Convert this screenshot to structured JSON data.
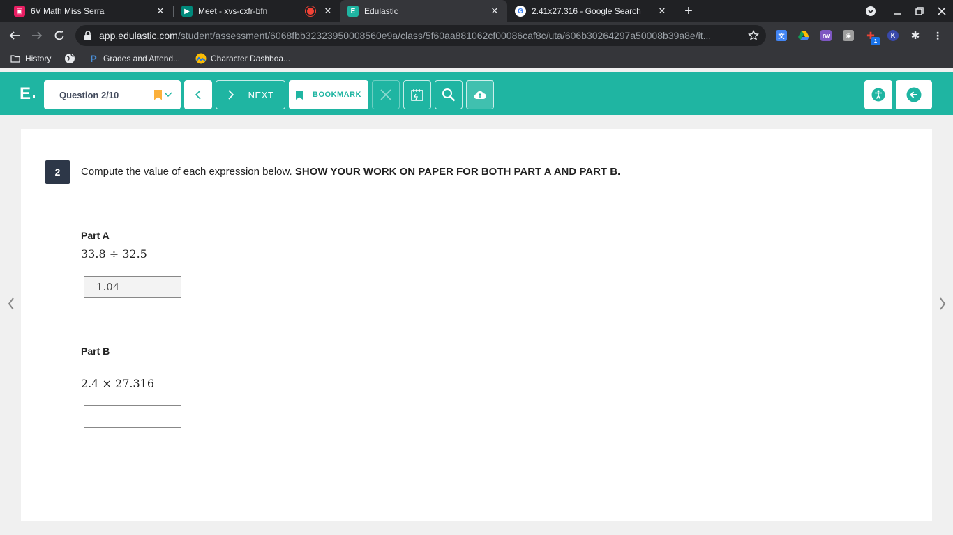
{
  "browser": {
    "tabs": [
      {
        "title": "6V Math Miss Serra",
        "favicon": "classroom-icon"
      },
      {
        "title": "Meet - xvs-cxfr-bfn",
        "favicon": "meet-icon",
        "recording": true
      },
      {
        "title": "Edulastic",
        "favicon": "edulastic-icon",
        "active": true
      },
      {
        "title": "2.41x27.316 - Google Search",
        "favicon": "google-icon"
      }
    ],
    "url_host": "app.edulastic.com",
    "url_path": "/student/assessment/6068fbb32323950008560e9a/class/5f60aa881062cf00086caf8c/uta/606b30264297a50008b39a8e/it...",
    "extension_badge": "1",
    "bookmarks": [
      {
        "label": "History",
        "icon": "folder-icon"
      },
      {
        "label": "",
        "icon": "globe-icon"
      },
      {
        "label": "Grades and Attend...",
        "icon": "powerschool-icon"
      },
      {
        "label": "Character Dashboa...",
        "icon": "character-icon"
      }
    ]
  },
  "header": {
    "logo": "E",
    "question_select": "Question 2/10",
    "next_label": "NEXT",
    "bookmark_label": "BOOKMARK",
    "accent_color": "#1fb5a2"
  },
  "question": {
    "number": "2",
    "prompt": "Compute the value of each expression below. ",
    "prompt_emphasis": "SHOW YOUR WORK ON PAPER FOR BOTH PART A AND PART B.",
    "parts": [
      {
        "label": "Part A",
        "expression": "33.8 ÷ 32.5",
        "answer": "1.04"
      },
      {
        "label": "Part B",
        "expression": "2.4 × 27.316",
        "answer": ""
      }
    ]
  }
}
